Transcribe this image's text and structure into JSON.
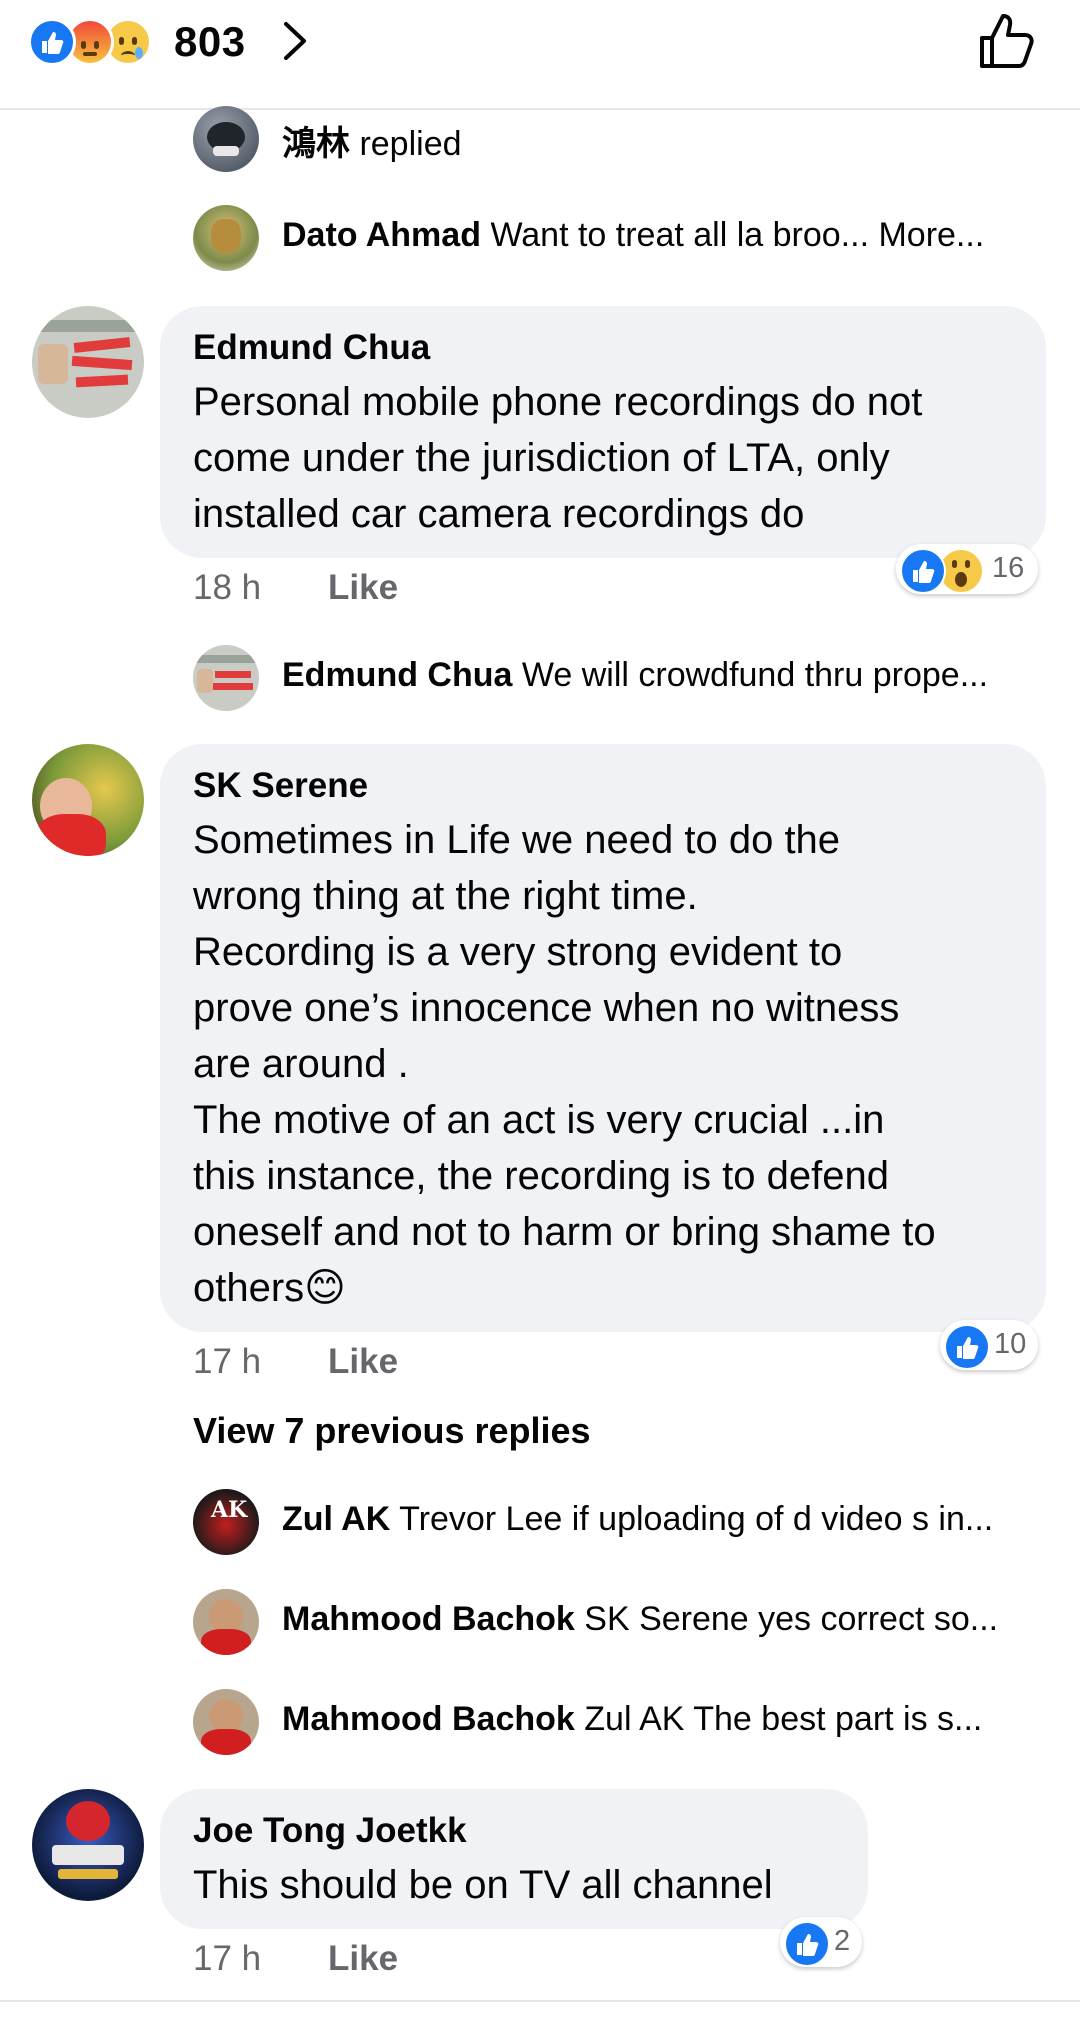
{
  "header": {
    "reaction_icons": [
      "like-icon",
      "angry-icon",
      "sad-icon"
    ],
    "reaction_count": "803"
  },
  "colors": {
    "accent": "#1877f2",
    "bubble": "#f0f2f5",
    "secondary_text": "#65676b"
  },
  "thread1": {
    "replies": [
      {
        "name": "鴻林",
        "text": "replied"
      },
      {
        "name": "Dato Ahmad",
        "text": "Want to treat all la broo... More..."
      }
    ]
  },
  "comment1": {
    "name": "Edmund Chua",
    "text": "Personal mobile phone recordings do not\ncome under the jurisdiction of LTA, only\ninstalled car camera recordings do",
    "time": "18 h",
    "like_label": "Like",
    "reaction_count": "16",
    "reply": {
      "name": "Edmund Chua",
      "text": "We will crowdfund thru prope..."
    }
  },
  "comment2": {
    "name": "SK Serene",
    "text": "Sometimes in Life we need to do the\nwrong thing at the right time.\nRecording is a very strong evident to\nprove one’s innocence when no witness\nare around .\nThe motive of an act is very crucial ...in\nthis instance, the recording is to defend\noneself and not to harm or bring shame to\nothers😊",
    "time": "17 h",
    "like_label": "Like",
    "reaction_count": "10",
    "view_previous": "View 7 previous replies",
    "replies": [
      {
        "name": "Zul AK",
        "text": "Trevor Lee if uploading of d video s in..."
      },
      {
        "name": "Mahmood Bachok",
        "text": "SK Serene yes correct so..."
      },
      {
        "name": "Mahmood Bachok",
        "text": "Zul AK The best part is s..."
      }
    ]
  },
  "comment3": {
    "name": "Joe Tong Joetkk",
    "text": "This should be on TV all channel",
    "time": "17 h",
    "like_label": "Like",
    "reaction_count": "2"
  }
}
